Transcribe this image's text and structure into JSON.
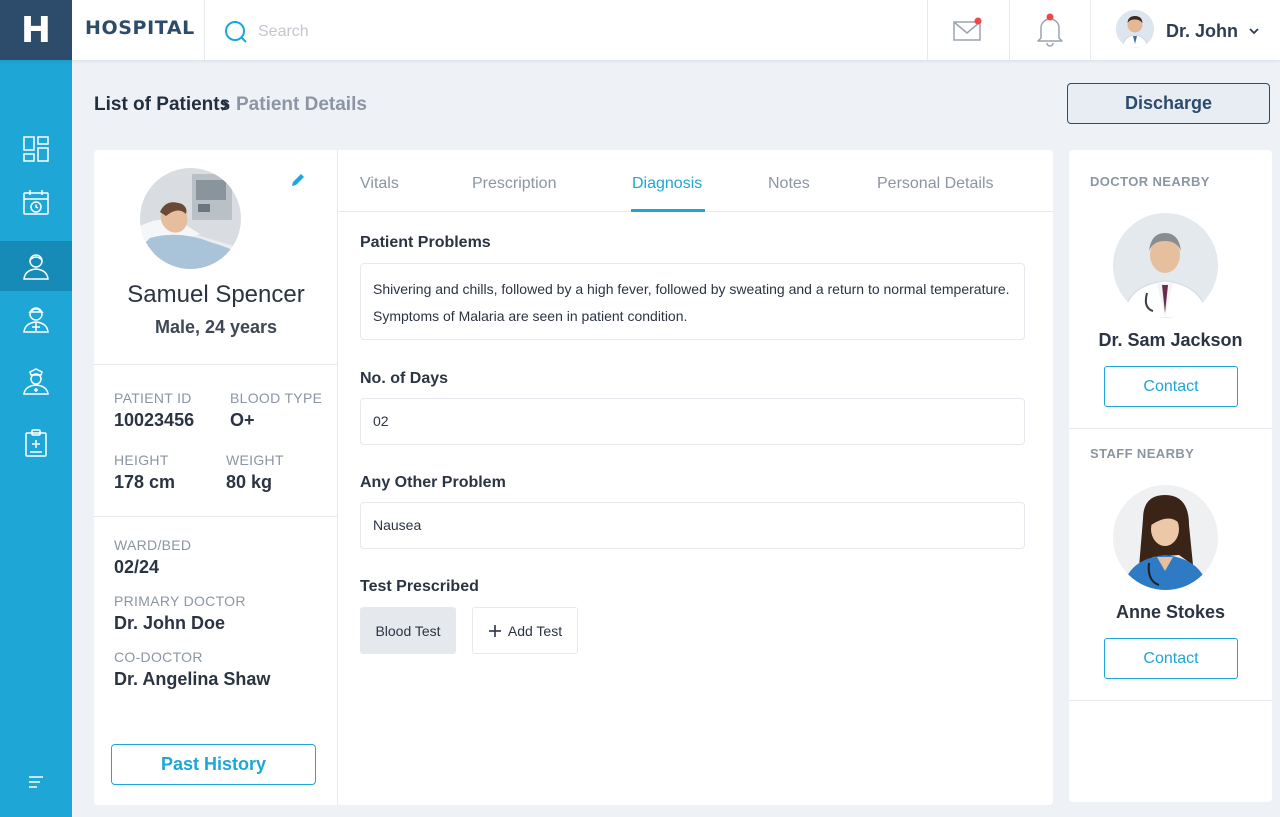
{
  "app": {
    "logo_letter": "H",
    "brand": "HOSPITAL"
  },
  "search": {
    "placeholder": "Search",
    "value": ""
  },
  "header": {
    "user_name": "Dr. John"
  },
  "sidebar": {
    "items": [
      {
        "icon": "dashboard-icon",
        "active": false
      },
      {
        "icon": "calendar-clock-icon",
        "active": false
      },
      {
        "icon": "patient-icon",
        "active": true
      },
      {
        "icon": "doctor-icon",
        "active": false
      },
      {
        "icon": "nurse-icon",
        "active": false
      },
      {
        "icon": "clipboard-medical-icon",
        "active": false
      }
    ],
    "menu_icon": "menu-icon"
  },
  "breadcrumb": {
    "parent": "List of Patients",
    "current": "Patient Details"
  },
  "actions": {
    "discharge": "Discharge"
  },
  "patient": {
    "name": "Samuel Spencer",
    "subtitle": "Male, 24 years",
    "id_label": "PATIENT ID",
    "id": "10023456",
    "blood_label": "BLOOD TYPE",
    "blood": "O+",
    "height_label": "HEIGHT",
    "height": "178 cm",
    "weight_label": "WEIGHT",
    "weight": "80 kg",
    "ward_label": "WARD/BED",
    "ward": "02/24",
    "primary_label": "PRIMARY DOCTOR",
    "primary": "Dr. John Doe",
    "co_label": "CO-DOCTOR",
    "co": "Dr. Angelina Shaw",
    "history_button": "Past History"
  },
  "tabs": [
    "Vitals",
    "Prescription",
    "Diagnosis",
    "Notes",
    "Personal Details"
  ],
  "active_tab": "Diagnosis",
  "diagnosis": {
    "problems_title": "Patient Problems",
    "problems_line1": "Shivering and chills, followed by a high fever, followed by sweating and a return to normal temperature.",
    "problems_line2": "Symptoms of Malaria are seen in patient condition.",
    "days_title": "No. of Days",
    "days_value": "02",
    "other_title": "Any Other Problem",
    "other_value": "Nausea",
    "test_title": "Test Prescribed",
    "tests": [
      "Blood Test"
    ],
    "add_test": "Add Test"
  },
  "nearby": {
    "doctor_label": "DOCTOR NEARBY",
    "doctor_name": "Dr. Sam Jackson",
    "staff_label": "STAFF NEARBY",
    "staff_name": "Anne Stokes",
    "contact": "Contact"
  },
  "colors": {
    "accent": "#1ea6d7",
    "brand": "#2d4b6b",
    "notification": "#f04848"
  }
}
